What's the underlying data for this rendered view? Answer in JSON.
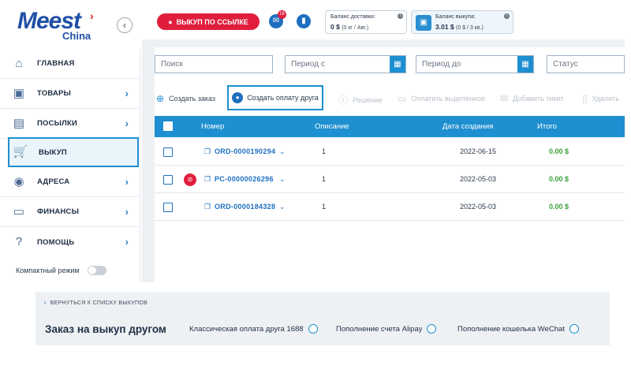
{
  "logo": {
    "main": "Meest",
    "sub": "China"
  },
  "sidebar": {
    "collapse_icon": "chevron-left-icon",
    "items": [
      {
        "label": "ГЛАВНАЯ",
        "icon": "home-icon"
      },
      {
        "label": "ТОВАРЫ",
        "icon": "bag-icon"
      },
      {
        "label": "ПОСЫЛКИ",
        "icon": "box-icon"
      },
      {
        "label": "ВЫКУП",
        "icon": "cart-icon"
      },
      {
        "label": "АДРЕСА",
        "icon": "location-icon"
      },
      {
        "label": "ФИНАНСЫ",
        "icon": "wallet-icon"
      },
      {
        "label": "ПОМОЩЬ",
        "icon": "help-icon"
      }
    ],
    "compact_label": "Компактный режим"
  },
  "topbar": {
    "buy_link_label": "ВЫКУП ПО ССЫЛКЕ",
    "mail_badge": "16",
    "delivery_balance": {
      "title": "Баланс доставки:",
      "value": "0 $",
      "sub": "(0 кг / Авг.)"
    },
    "buyout_balance": {
      "title": "Баланс выкупа:",
      "value": "3.01 $",
      "sub": "(0 $ / 3 кв.)"
    }
  },
  "filters": {
    "search": "Поиск",
    "period_from": "Период с",
    "period_to": "Период до",
    "status": "Статус"
  },
  "actions": {
    "create_order": "Создать заказ",
    "create_friend_payment": "Создать оплату друга",
    "solution": "Решение",
    "pay_selected": "Оплатить выделенное",
    "add_ticket": "Добавить тикет",
    "delete": "Удалить"
  },
  "table": {
    "headers": {
      "number": "Номер",
      "description": "Описание",
      "created": "Дата создания",
      "total": "Итого"
    },
    "rows": [
      {
        "number": "ORD-0000190294",
        "description": "1",
        "created": "2022-06-15",
        "total": "0.00 $"
      },
      {
        "number": "PC-00000026296",
        "description": "1",
        "created": "2022-05-03",
        "total": "0.00 $"
      },
      {
        "number": "ORD-0000184328",
        "description": "1",
        "created": "2022-05-03",
        "total": "0.00 $"
      }
    ]
  },
  "bottom": {
    "back_label": "ВЕРНУТЬСЯ К СПИСКУ ВЫКУПОВ",
    "title": "Заказ на выкуп другом",
    "options": [
      "Классическая оплата друга 1688",
      "Пополнение счета Alipay",
      "Пополнение кошелька WeChat"
    ]
  },
  "colors": {
    "accent": "#1e8fd0",
    "brand_red": "#e01e3c",
    "brand_blue": "#1f4fa6",
    "total_green": "#3aa33a"
  }
}
